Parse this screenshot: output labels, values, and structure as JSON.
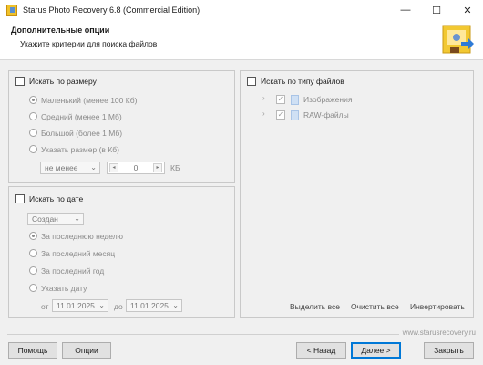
{
  "window": {
    "title": "Starus Photo Recovery 6.8 (Commercial Edition)",
    "minimize": "—",
    "maximize": "☐",
    "close": "✕"
  },
  "header": {
    "title": "Дополнительные опции",
    "subtitle": "Укажите критерии для поиска файлов"
  },
  "size_panel": {
    "checkbox_label": "Искать по размеру",
    "options": [
      {
        "label": "Маленький (менее 100 Кб)",
        "selected": true
      },
      {
        "label": "Средний (менее 1 Мб)",
        "selected": false
      },
      {
        "label": "Большой (более 1 Мб)",
        "selected": false
      },
      {
        "label": "Указать размер (в Кб)",
        "selected": false
      }
    ],
    "condition": "не менее",
    "value": "0",
    "unit": "КБ"
  },
  "date_panel": {
    "checkbox_label": "Искать по дате",
    "date_type": "Создан",
    "options": [
      {
        "label": "За последнюю неделю",
        "selected": true
      },
      {
        "label": "За последний месяц",
        "selected": false
      },
      {
        "label": "За последний год",
        "selected": false
      },
      {
        "label": "Указать дату",
        "selected": false
      }
    ],
    "from_label": "от",
    "from_date": "11.01.2025",
    "to_label": "до",
    "to_date": "11.01.2025"
  },
  "type_panel": {
    "checkbox_label": "Искать по типу файлов",
    "items": [
      "Изображения",
      "RAW-файлы"
    ],
    "select_all": "Выделить все",
    "clear_all": "Очистить все",
    "invert": "Инвертировать"
  },
  "footer": {
    "website": "www.starusrecovery.ru",
    "help": "Помощь",
    "options": "Опции",
    "back": "< Назад",
    "next": "Далее >",
    "close": "Закрыть"
  }
}
